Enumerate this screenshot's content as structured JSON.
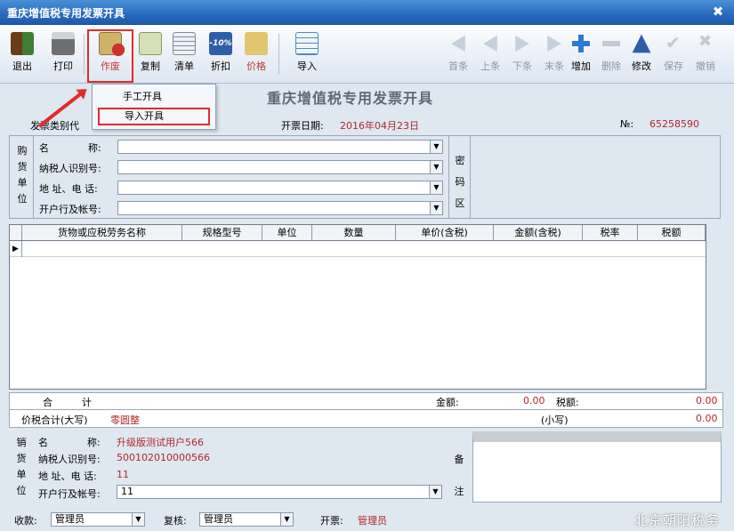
{
  "window": {
    "title": "重庆增值税专用发票开具",
    "close_glyph": "✖"
  },
  "toolbar": {
    "left": [
      {
        "label": "退出",
        "icon": "exit-icon"
      },
      {
        "label": "打印",
        "icon": "printer-icon"
      },
      {
        "label": "作废",
        "icon": "void-icon"
      },
      {
        "label": "复制",
        "icon": "copy-icon"
      },
      {
        "label": "清单",
        "icon": "list-icon"
      },
      {
        "label": "折扣",
        "icon": "discount-icon",
        "icon_text": "-10%"
      },
      {
        "label": "价格",
        "icon": "price-icon"
      },
      {
        "label": "导入",
        "icon": "import-icon"
      }
    ],
    "right": [
      {
        "label": "首条"
      },
      {
        "label": "上条"
      },
      {
        "label": "下条"
      },
      {
        "label": "末条"
      },
      {
        "label": "增加"
      },
      {
        "label": "删除"
      },
      {
        "label": "修改"
      },
      {
        "label": "保存"
      },
      {
        "label": "撤销"
      }
    ]
  },
  "dropdown": {
    "items": [
      "手工开具",
      "导入开具"
    ]
  },
  "invoice": {
    "title": "重庆增值税专用发票开具",
    "type_label": "发票类别代",
    "date_label": "开票日期:",
    "date_value": "2016年04月23日",
    "no_label": "№:",
    "no_value": "65258590"
  },
  "buyer": {
    "section": [
      "购",
      "货",
      "单",
      "位"
    ],
    "labels": [
      "名　　　　称:",
      "纳税人识别号:",
      "地 址、电 话:",
      "开户行及帐号:"
    ],
    "cipher": [
      "密",
      "码",
      "区"
    ]
  },
  "grid": {
    "columns": [
      "货物或应税劳务名称",
      "规格型号",
      "单位",
      "数量",
      "单价(含税)",
      "金额(含税)",
      "税率",
      "税额"
    ],
    "row_marker": "▶"
  },
  "totals": {
    "sum_label": "合　　　计",
    "amount_label": "金额:",
    "amount_value": "0.00",
    "tax_label": "税额:",
    "tax_value": "0.00",
    "price_tax_label": "价税合计(大写)",
    "price_tax_upper": "零圆整",
    "small_label": "(小写)",
    "small_value": "0.00"
  },
  "seller": {
    "section": [
      "销",
      "货",
      "单",
      "位"
    ],
    "labels": [
      "名　　　　称:",
      "纳税人识别号:",
      "地 址、电 话:",
      "开户行及帐号:"
    ],
    "name": "升级版测试用户566",
    "tax_id": "500102010000566",
    "address_phone": "11",
    "bank_account": "11",
    "remark": [
      "备",
      "注"
    ]
  },
  "signatures": {
    "payee_label": "收款:",
    "payee_value": "管理员",
    "reviewer_label": "复核:",
    "reviewer_value": "管理员",
    "drawer_label": "开票:",
    "drawer_value": "管理员"
  },
  "watermark": "北京朝阳税务"
}
